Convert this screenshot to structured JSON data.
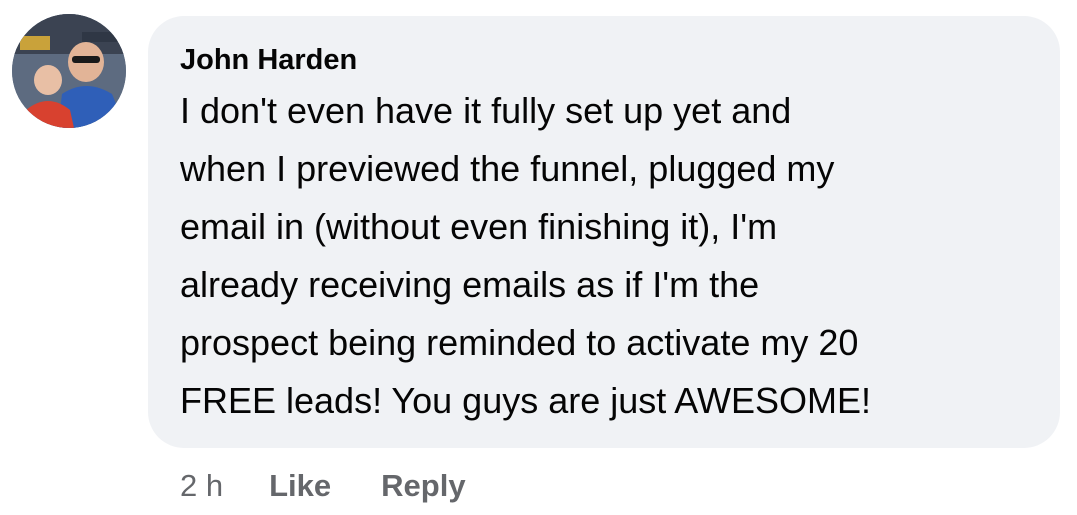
{
  "comment": {
    "author": "John Harden",
    "text": "I don't even have it fully set up yet and\nwhen I previewed the funnel, plugged my\nemail in (without even finishing it), I'm\nalready receiving emails as if I'm the\nprospect being reminded to activate my 20\nFREE leads!  You guys are just AWESOME!",
    "avatar_icon": "profile-photo",
    "timestamp": "2 h",
    "like_label": "Like",
    "reply_label": "Reply"
  },
  "colors": {
    "bubble_bg": "#f0f2f5",
    "text": "#050505",
    "secondary_text": "#65676b"
  }
}
